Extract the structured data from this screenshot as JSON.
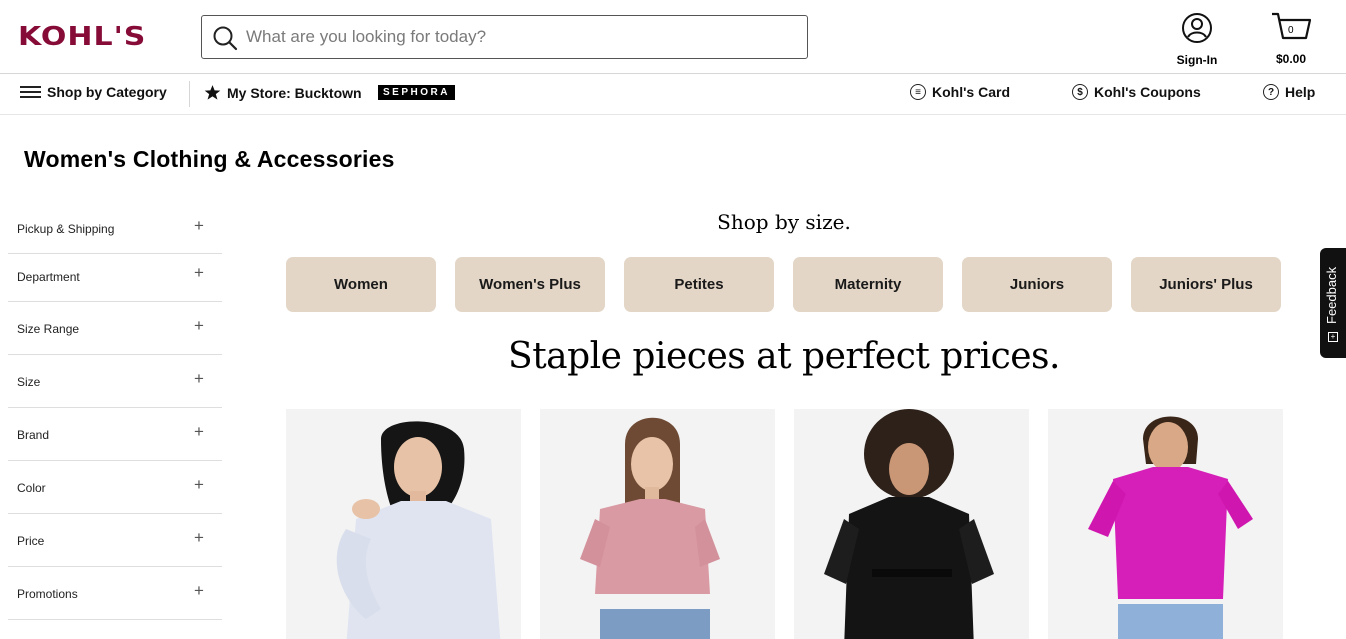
{
  "header": {
    "logo": "KOHL'S",
    "search_placeholder": "What are you looking for today?",
    "signin_label": "Sign-In",
    "cart_count": "0",
    "cart_total": "$0.00"
  },
  "nav": {
    "shop_by_category": "Shop by Category",
    "my_store": "My Store: Bucktown",
    "sephora": "SEPHORA",
    "kohls_card": "Kohl's Card",
    "kohls_coupons": "Kohl's Coupons",
    "help": "Help"
  },
  "page": {
    "title": "Women's Clothing & Accessories"
  },
  "filters": [
    {
      "label": "Pickup & Shipping"
    },
    {
      "label": "Department"
    },
    {
      "label": "Size Range"
    },
    {
      "label": "Size"
    },
    {
      "label": "Brand"
    },
    {
      "label": "Color"
    },
    {
      "label": "Price"
    },
    {
      "label": "Promotions"
    }
  ],
  "size_section": {
    "heading": "Shop by size.",
    "buttons": [
      "Women",
      "Women's Plus",
      "Petites",
      "Maternity",
      "Juniors",
      "Juniors' Plus"
    ]
  },
  "staple_heading": "Staple pieces at perfect prices.",
  "feedback": "Feedback",
  "colors": {
    "brand": "#860b37",
    "size_button": "#e3d6c6"
  }
}
